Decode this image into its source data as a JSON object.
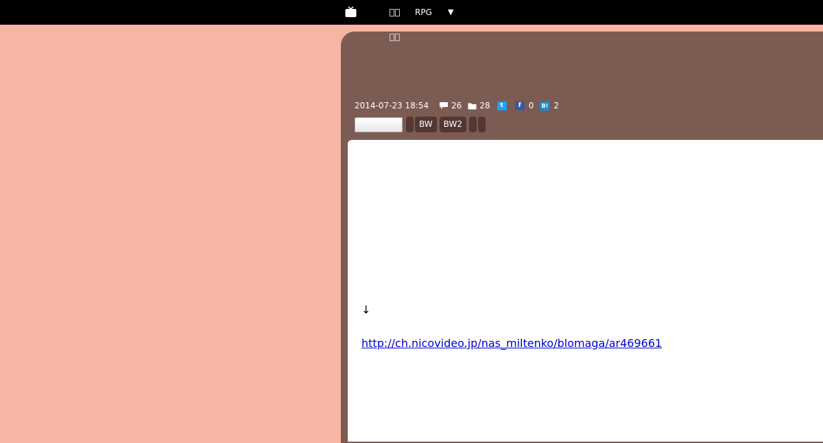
{
  "header": {
    "icons": {
      "logo": "tv-icon"
    },
    "nav_item_1": "",
    "nav_rpg": "RPG",
    "nav_menu": "▼",
    "sub_nav_item": ""
  },
  "article": {
    "date": "2014-07-23 18:54",
    "comments_count": "26",
    "folder_count": "28",
    "facebook_count": "0",
    "hatena_count": "2",
    "share_icons": [
      "twitter-icon",
      "facebook-icon",
      "hatena-bookmark-icon"
    ],
    "tags": [
      "",
      "BW",
      "BW2",
      "",
      ""
    ],
    "body_arrow": "↓",
    "link_url": "http://ch.nicovideo.jp/nas_miltenko/blomaga/ar469661"
  },
  "colors": {
    "page_background": "#f7b5a5",
    "topbar": "#000000",
    "article_header": "#7c5b52",
    "tag_background": "#523733",
    "content_background": "#ffffff",
    "link": "#0000cc"
  }
}
